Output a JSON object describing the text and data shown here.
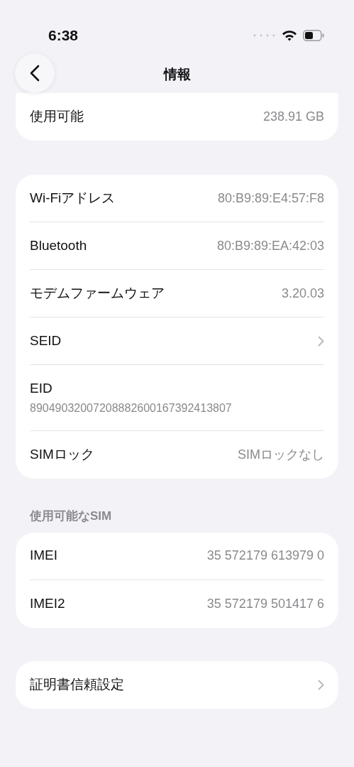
{
  "status_bar": {
    "time": "6:38"
  },
  "nav": {
    "title": "情報"
  },
  "groups": [
    {
      "rows": [
        {
          "kind": "value",
          "label": "使用可能",
          "value": "238.91 GB"
        }
      ]
    },
    {
      "rows": [
        {
          "kind": "value",
          "label": "Wi-Fiアドレス",
          "value": "80:B9:89:E4:57:F8"
        },
        {
          "kind": "value",
          "label": "Bluetooth",
          "value": "80:B9:89:EA:42:03"
        },
        {
          "kind": "value",
          "label": "モデムファームウェア",
          "value": "3.20.03"
        },
        {
          "kind": "chevron",
          "label": "SEID"
        },
        {
          "kind": "stacked",
          "label": "EID",
          "value": "89049032007208882600167392413807"
        },
        {
          "kind": "value",
          "label": "SIMロック",
          "value": "SIMロックなし"
        }
      ]
    },
    {
      "header": "使用可能なSIM",
      "rows": [
        {
          "kind": "value",
          "label": "IMEI",
          "value": "35 572179 613979 0"
        },
        {
          "kind": "value",
          "label": "IMEI2",
          "value": "35 572179 501417 6"
        }
      ]
    },
    {
      "rows": [
        {
          "kind": "chevron",
          "label": "証明書信頼設定"
        }
      ]
    }
  ]
}
